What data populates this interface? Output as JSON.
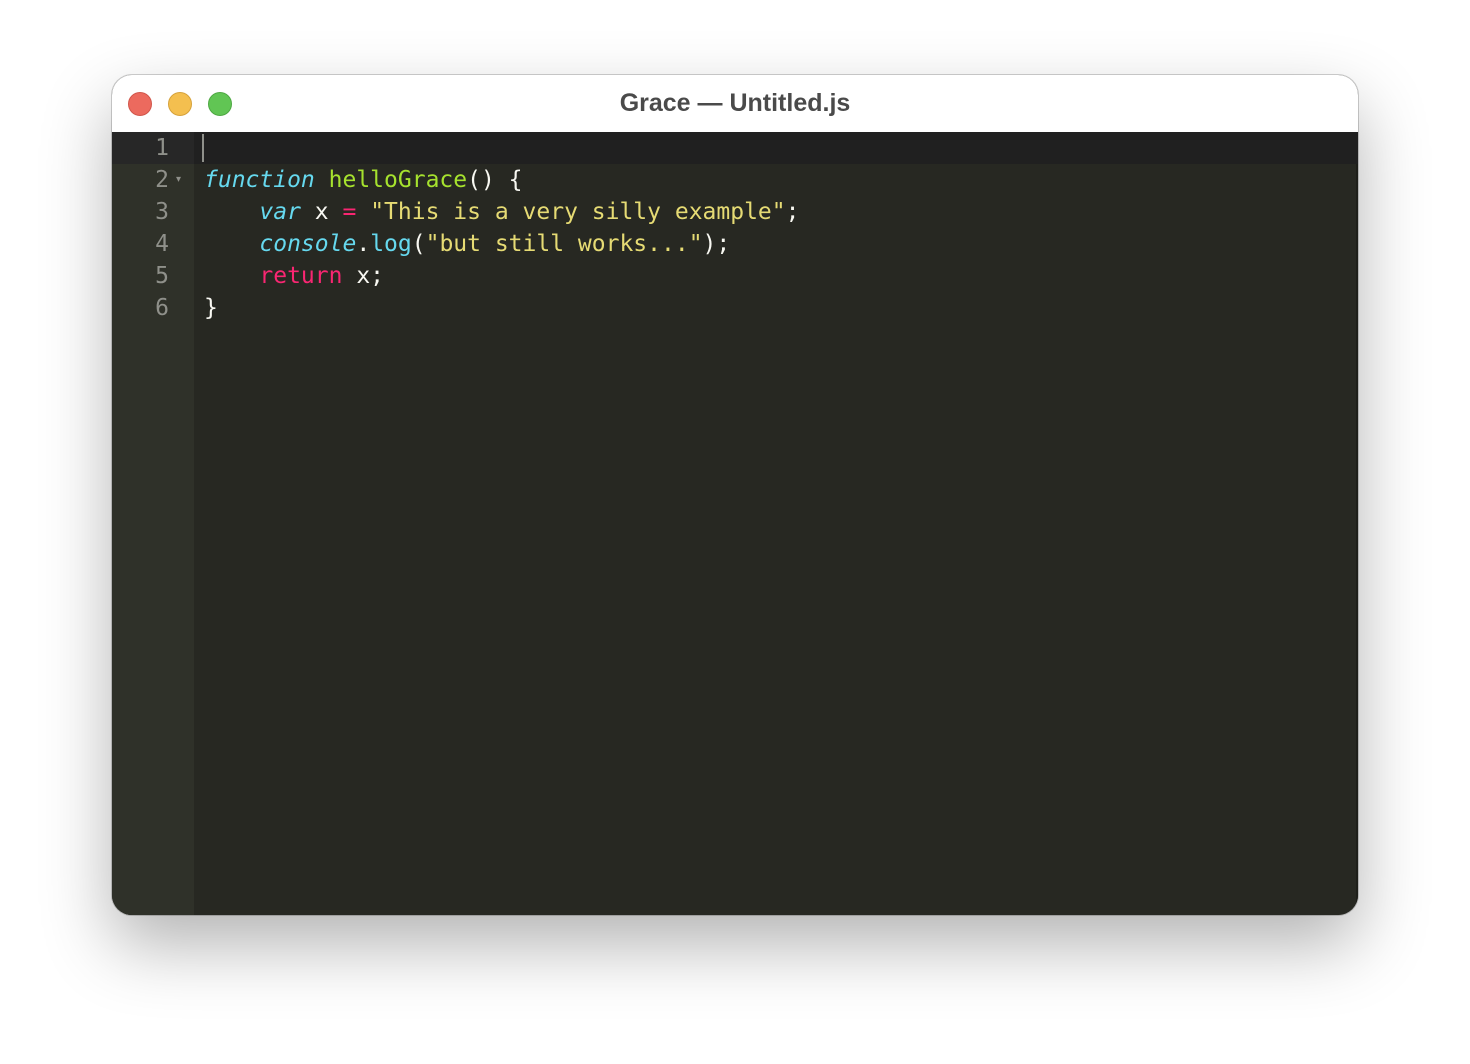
{
  "window": {
    "title": "Grace — Untitled.js"
  },
  "colors": {
    "background": "#272822",
    "gutter": "#2f3129",
    "keyword": "#66d9ef",
    "function_name": "#a6e22e",
    "string": "#e6db74",
    "operator": "#f92672"
  },
  "editor": {
    "language": "javascript",
    "line_numbers": [
      "1",
      "2",
      "3",
      "4",
      "5",
      "6"
    ],
    "fold_marker": "▾",
    "lines": [
      {
        "tokens": []
      },
      {
        "tokens": [
          {
            "t": "kw-storage",
            "v": "function"
          },
          {
            "t": "plain",
            "v": " "
          },
          {
            "t": "fn-name",
            "v": "helloGrace"
          },
          {
            "t": "plain",
            "v": "() {"
          }
        ]
      },
      {
        "tokens": [
          {
            "t": "plain",
            "v": "    "
          },
          {
            "t": "kw-storage",
            "v": "var"
          },
          {
            "t": "plain",
            "v": " x "
          },
          {
            "t": "op",
            "v": "="
          },
          {
            "t": "plain",
            "v": " "
          },
          {
            "t": "str",
            "v": "\"This is a very silly example\""
          },
          {
            "t": "plain",
            "v": ";"
          }
        ]
      },
      {
        "tokens": [
          {
            "t": "plain",
            "v": "    "
          },
          {
            "t": "sup",
            "v": "console"
          },
          {
            "t": "plain",
            "v": "."
          },
          {
            "t": "method",
            "v": "log"
          },
          {
            "t": "plain",
            "v": "("
          },
          {
            "t": "str",
            "v": "\"but still works...\""
          },
          {
            "t": "plain",
            "v": ");"
          }
        ]
      },
      {
        "tokens": [
          {
            "t": "plain",
            "v": "    "
          },
          {
            "t": "kw-flow",
            "v": "return"
          },
          {
            "t": "plain",
            "v": " x;"
          }
        ]
      },
      {
        "tokens": [
          {
            "t": "plain",
            "v": "}"
          }
        ]
      }
    ]
  }
}
